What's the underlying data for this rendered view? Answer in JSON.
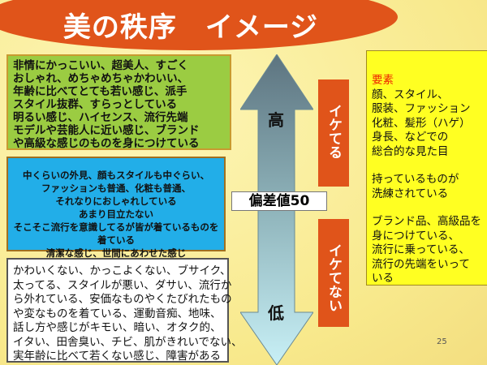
{
  "title": "美の秩序　イメージ",
  "high_group": {
    "lines": [
      "非情にかっこいい、超美人、すごく",
      "おしゃれ、めちゃめちゃかわいい、",
      "年齢に比べてとても若い感じ、派手",
      "スタイル抜群、すらっとしている",
      "明るい感じ、ハイセンス、流行先端",
      "モデルや芸能人に近い感じ、ブランド",
      "や高級な感じのものを身につけている"
    ]
  },
  "mid_group": {
    "lines": [
      "中くらいの外見、顔もスタイルも中ぐらい、",
      "ファッションも普通、化粧も普通、",
      "それなりにおしゃれしている",
      "あまり目立たない",
      "そこそこ流行を意識してるが皆が着ているものを",
      "着ている",
      "清潔な感じ、世間にあわせた感じ"
    ]
  },
  "low_group": {
    "lines": [
      "かわいくない、かっこよくない、ブサイク、",
      "太ってる、スタイルが悪い、ダサい、流行か",
      "ら外れている、安価なものやくたびれたもの",
      "や変なものを着ている、運動音痴、地味、",
      "話し方や感じがキモい、暗い、オタク的、",
      "イタい、田舎臭い、チビ、肌がきれいでない、",
      "実年齢に比べて若くない感じ、障害がある"
    ]
  },
  "scale": {
    "high": "高",
    "low": "低",
    "midpoint": "偏差値50",
    "cool": "イケてる",
    "not_cool": "イケてない"
  },
  "elements": {
    "heading": "要素",
    "para1": [
      "顔、スタイル、",
      "服装、ファッション",
      "化粧、髪形（ハゲ）",
      "身長、などでの",
      "総合的な見た目"
    ],
    "para2": [
      "持っているものが",
      "洗練されている"
    ],
    "para3": [
      "ブランド品、高級品を",
      "身につけている、",
      "流行に乗っている、",
      "流行の先端をいって",
      "いる"
    ]
  },
  "slide_number": "25",
  "colors": {
    "title_bg": "#e0541a",
    "high_bg": "#9bcc42",
    "mid_bg": "#22aee8",
    "elements_bg": "#ffff22",
    "heading_text": "#ee2200"
  }
}
